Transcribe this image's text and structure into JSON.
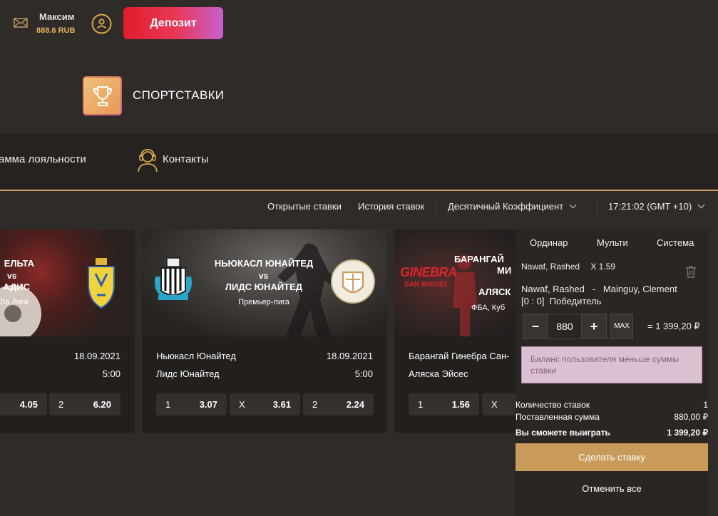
{
  "header": {
    "user_name": "Максим",
    "balance": "888.6 RUB",
    "deposit_label": "Депозит"
  },
  "sport": {
    "title": "СПОРТСТАВКИ"
  },
  "nav": {
    "loyalty_label": "амма лояльности",
    "contacts_label": "Контакты"
  },
  "subbar": {
    "open_bets": "Открытые ставки",
    "history": "История ставок",
    "odds_format": "Десятичный Коэффициент",
    "time": "17:21:02 (GMT +10)"
  },
  "events": [
    {
      "team1_banner": "ЕЛЬТА",
      "vs": "vs",
      "team2_banner": "АДИС",
      "league": "Ла Лига",
      "date": "18.09.2021",
      "time": "5:00",
      "odds": [
        {
          "label": "",
          "value": "4.05"
        },
        {
          "label": "2",
          "value": "6.20"
        }
      ]
    },
    {
      "team1_banner": "НЬЮКАСЛ ЮНАЙТЕД",
      "vs": "vs",
      "team2_banner": "ЛИДС ЮНАЙТЕД",
      "league": "Премьер-лига",
      "team1": "Ньюкасл Юнайтед",
      "team2": "Лидс Юнайтед",
      "date": "18.09.2021",
      "time": "5:00",
      "odds": [
        {
          "label": "1",
          "value": "3.07"
        },
        {
          "label": "X",
          "value": "3.61"
        },
        {
          "label": "2",
          "value": "2.24"
        }
      ]
    },
    {
      "team1_banner": "БАРАНГАЙ",
      "team1_banner_2": "МИ",
      "team2_banner": "АЛЯСК",
      "league": "ФБА, Куб",
      "team1": "Барангай Гинебра Сан-",
      "team2": "Аляска Эйсес",
      "logo_text_1": "GINEBRA",
      "logo_text_2": "SAN MIGUEL",
      "odds": [
        {
          "label": "1",
          "value": "1.56"
        },
        {
          "label": "X",
          "value": ""
        }
      ]
    }
  ],
  "slip": {
    "tabs": [
      "Ординар",
      "Мульти",
      "Система"
    ],
    "bet_head": "Nawaf, Rashed",
    "bet_odds": "X 1.59",
    "match_line": "Nawaf, Rashed   -   Mainguy, Clement",
    "market_line": "[0 : 0]  Победитель",
    "stake": "880",
    "minus": "−",
    "plus": "+",
    "max": "MAX",
    "potential": "= 1 399,20 ₽",
    "warning": "Баланс пользователя меньше суммы ставки",
    "count_label": "Количество ставок",
    "count_value": "1",
    "placed_label": "Поставленная сумма",
    "placed_value": "880,00 ₽",
    "win_label": "Вы сможете выиграть",
    "win_value": "1 399,20 ₽",
    "place_bet": "Сделать ставку",
    "cancel_all": "Отменить все"
  },
  "colors": {
    "accent_gold": "#c99b5b",
    "deposit_red": "#e41c2c",
    "deposit_pink": "#c760d0",
    "background": "#2f2b29"
  }
}
